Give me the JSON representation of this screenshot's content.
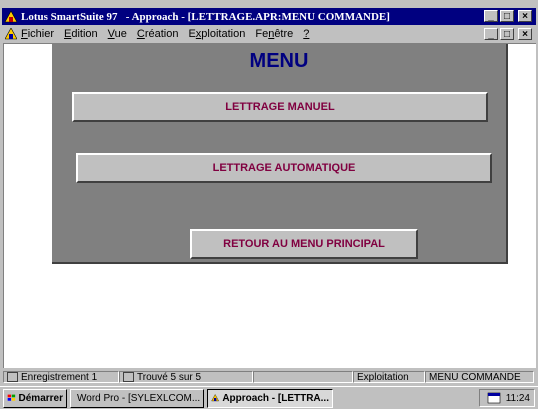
{
  "window": {
    "title": "Lotus SmartSuite 97   - Approach - [LETTRAGE.APR:MENU COMMANDE]",
    "minimize": "_",
    "maximize": "□",
    "close": "×"
  },
  "menubar": {
    "items": [
      {
        "label": "Fichier",
        "underline": "F"
      },
      {
        "label": "Edition",
        "underline": "E"
      },
      {
        "label": "Vue",
        "underline": "V"
      },
      {
        "label": "Création",
        "underline": "C"
      },
      {
        "label": "Exploitation",
        "underline": "x"
      },
      {
        "label": "Fenêtre",
        "underline": "n"
      },
      {
        "label": "?",
        "underline": "?"
      }
    ]
  },
  "form": {
    "title": "MENU",
    "buttons": [
      {
        "label": "LETTRAGE MANUEL"
      },
      {
        "label": "LETTRAGE AUTOMATIQUE"
      },
      {
        "label": "RETOUR AU MENU PRINCIPAL"
      }
    ]
  },
  "statusbar": {
    "record": "Enregistrement 1",
    "found": "Trouvé 5 sur 5",
    "mode": "Exploitation",
    "view": "MENU COMMANDE"
  },
  "taskbar": {
    "start": "Démarrer",
    "tasks": [
      {
        "label": "Word Pro - [SYLEXLCOM..."
      },
      {
        "label": "Approach - [LETTRA..."
      }
    ],
    "clock": "11:24"
  },
  "colors": {
    "title_bar": "#000080",
    "panel": "#808080",
    "button_text": "#800040",
    "menu_title": "#000080"
  }
}
